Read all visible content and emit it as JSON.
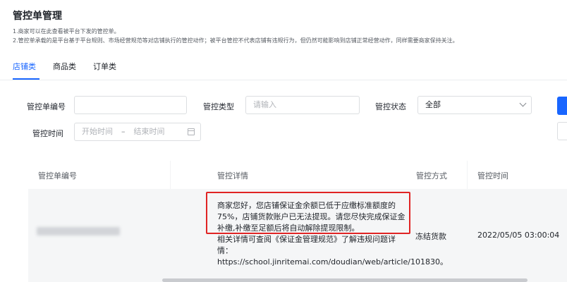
{
  "page": {
    "title": "管控单管理",
    "notes": [
      "1.商家可以在此查看被平台下发的管控单。",
      "2.管控单承载的是平台基于平台规则、市场经营规范等对店铺执行的管控动作；被平台管控不代表店铺有违规行为，但仍然可能影响到店铺正常经营动作，同样需要商家保持关注。"
    ]
  },
  "tabs": [
    {
      "label": "店铺类",
      "active": true
    },
    {
      "label": "商品类",
      "active": false
    },
    {
      "label": "订单类",
      "active": false
    }
  ],
  "filters": {
    "order_no_label": "管控单编号",
    "order_no_value": "",
    "type_label": "管控类型",
    "type_placeholder": "请输入",
    "status_label": "管控状态",
    "status_value": "全部",
    "time_label": "管控时间",
    "time_start_placeholder": "开始时间",
    "time_separator": "–",
    "time_end_placeholder": "结束时间"
  },
  "table": {
    "columns": [
      "管控单编号",
      "管控详情",
      "管控方式",
      "管控时间"
    ],
    "rows": [
      {
        "detail_highlighted": "商家您好，您店铺保证金余额已低于应缴标准额度的75%，店铺货款账户已无法提现。请您尽快完成保证金补缴,补缴至足额后将自动解除提现限制。",
        "detail_rest": "相关详情可查阅《保证金管理规范》了解违规问题详情：https://school.jinritemai.com/doudian/web/article/101830。",
        "method": "冻结货款",
        "time": "2022/05/05 03:00:04"
      }
    ]
  },
  "colors": {
    "accent": "#1966ff",
    "highlight_border": "#e02424"
  }
}
